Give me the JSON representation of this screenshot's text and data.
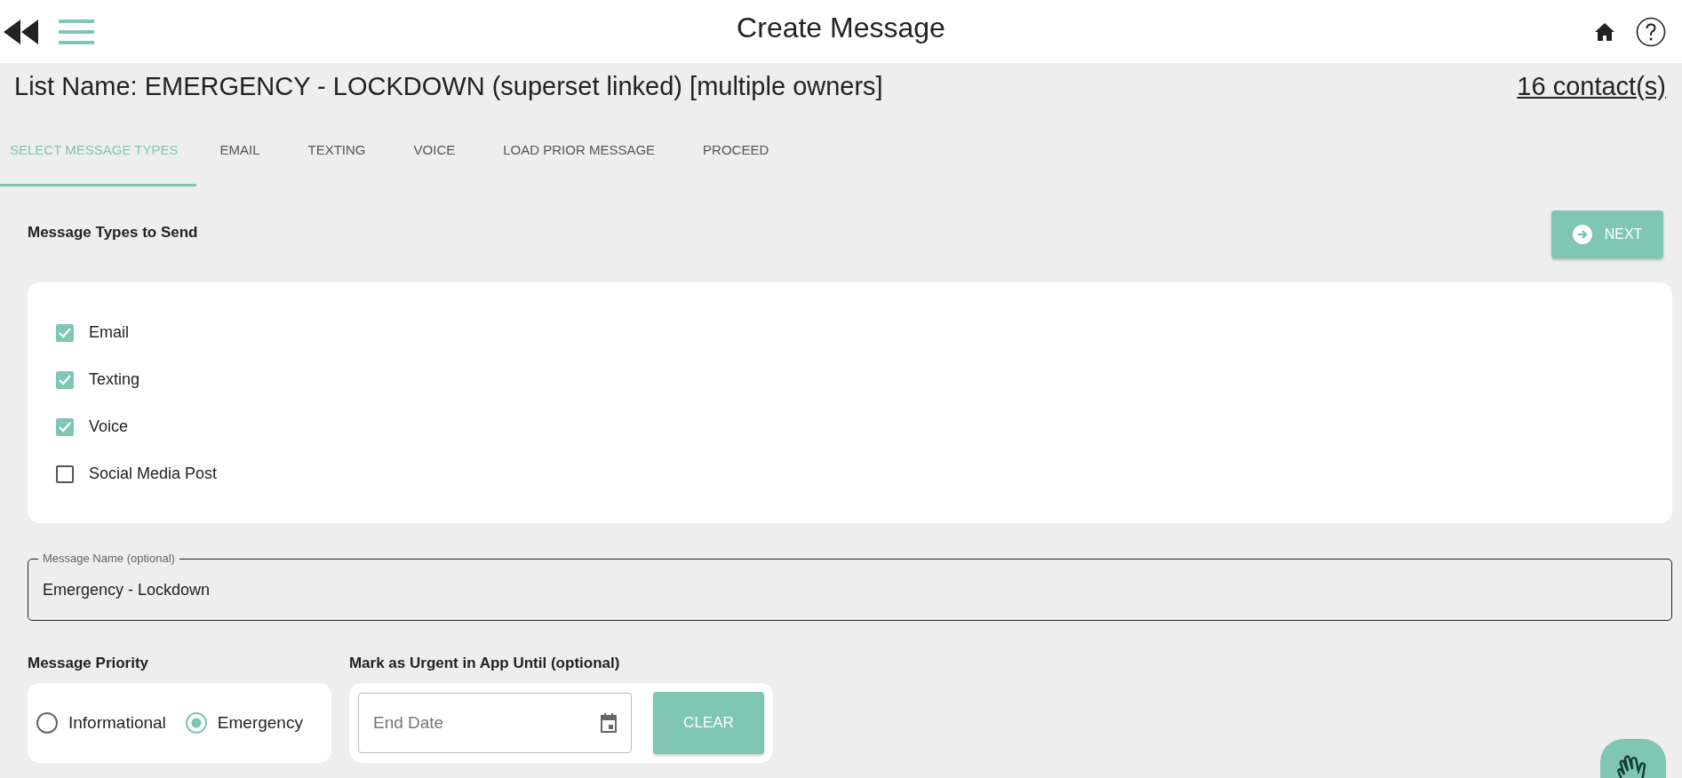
{
  "header": {
    "title": "Create Message"
  },
  "list_bar": {
    "list_name": "List Name: EMERGENCY - LOCKDOWN (superset linked) [multiple owners]",
    "contacts_link": "16 contact(s)"
  },
  "tabs": [
    {
      "label": "SELECT MESSAGE TYPES",
      "selected": true
    },
    {
      "label": "EMAIL",
      "selected": false
    },
    {
      "label": "TEXTING",
      "selected": false
    },
    {
      "label": "VOICE",
      "selected": false
    },
    {
      "label": "LOAD PRIOR MESSAGE",
      "selected": false
    },
    {
      "label": "PROCEED",
      "selected": false
    }
  ],
  "message_types": {
    "heading": "Message Types to Send",
    "next_button": "NEXT",
    "options": [
      {
        "label": "Email",
        "checked": true
      },
      {
        "label": "Texting",
        "checked": true
      },
      {
        "label": "Voice",
        "checked": true
      },
      {
        "label": "Social Media Post",
        "checked": false
      }
    ]
  },
  "message_name": {
    "label": "Message Name (optional)",
    "value": "Emergency - Lockdown"
  },
  "priority": {
    "heading": "Message Priority",
    "options": [
      {
        "label": "Informational",
        "selected": false
      },
      {
        "label": "Emergency",
        "selected": true
      }
    ]
  },
  "urgent_until": {
    "heading": "Mark as Urgent in App Until (optional)",
    "placeholder": "End Date",
    "clear_button": "CLEAR"
  }
}
